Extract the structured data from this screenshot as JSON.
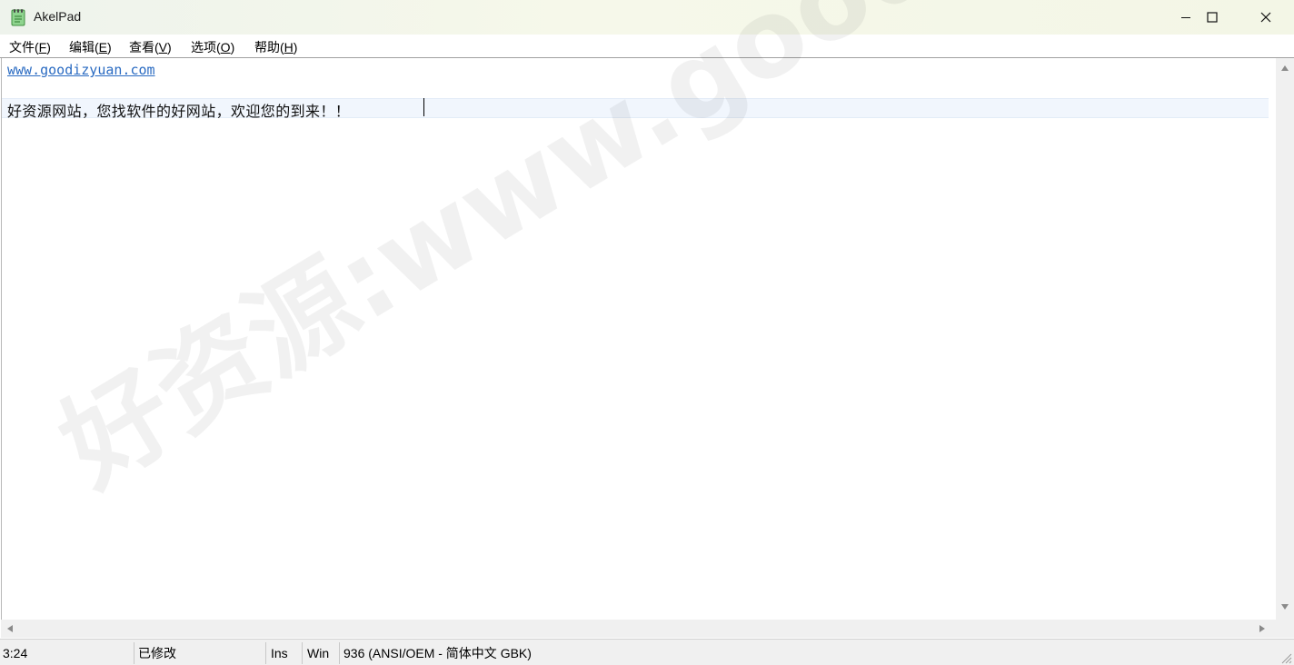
{
  "window": {
    "title": "AkelPad",
    "minimize_label": "Minimize",
    "maximize_label": "Maximize",
    "close_label": "Close"
  },
  "menu": {
    "items": [
      {
        "label": "文件(",
        "key": "F",
        "end": ")"
      },
      {
        "label": "编辑(",
        "key": "E",
        "end": ")"
      },
      {
        "label": "查看(",
        "key": "V",
        "end": ")"
      },
      {
        "label": "选项(",
        "key": "O",
        "end": ")"
      },
      {
        "label": "帮助(",
        "key": "H",
        "end": ")"
      }
    ]
  },
  "editor": {
    "lines": [
      "www.goodizyuan.com",
      "",
      "好资源网站，您找软件的好网站，欢迎您的到来！！"
    ]
  },
  "status": {
    "position": "3:24",
    "modified": "已修改",
    "insert_mode": "Ins",
    "newline": "Win",
    "codepage": "936  (ANSI/OEM - 简体中文 GBK)"
  },
  "watermark": "好资源:www.goodziyuan.com",
  "colors": {
    "link": "#2a6bc2",
    "active_line": "#f1f6fd",
    "titlebar": "#f6f8ea"
  }
}
